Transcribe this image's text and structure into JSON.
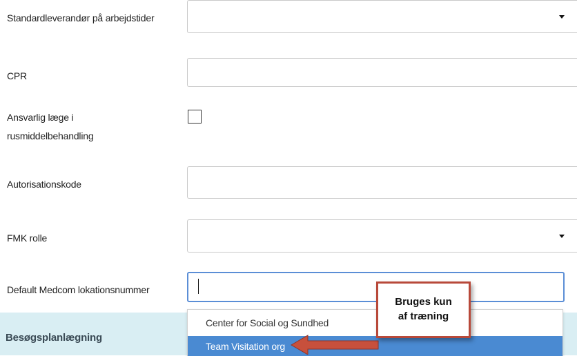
{
  "fields": {
    "standard_supplier": {
      "label": "Standardleverandør på arbejdstider",
      "value": ""
    },
    "cpr": {
      "label": "CPR",
      "value": ""
    },
    "responsible_doctor": {
      "label_line1": "Ansvarlig læge i",
      "label_line2": "rusmiddelbehandling",
      "checked": false
    },
    "authorization_code": {
      "label": "Autorisationskode",
      "value": ""
    },
    "fmk_role": {
      "label": "FMK rolle",
      "value": ""
    },
    "medcom_location": {
      "label": "Default Medcom lokationsnummer",
      "value": ""
    }
  },
  "dropdown": {
    "options": [
      "Center for Social og Sundhed",
      "Team Visitation org"
    ],
    "highlighted_index": 1
  },
  "section": {
    "title": "Besøgsplanlægning"
  },
  "callout": {
    "line1": "Bruges kun",
    "line2": "af træning"
  },
  "colors": {
    "highlight": "#4a8ad2",
    "callout_border": "#b8493a",
    "section_band": "#d9eef3",
    "focus_border": "#5b8ed6"
  },
  "icons": {
    "select_caret": "chevron-down-icon",
    "pointer": "red-arrow-icon"
  }
}
